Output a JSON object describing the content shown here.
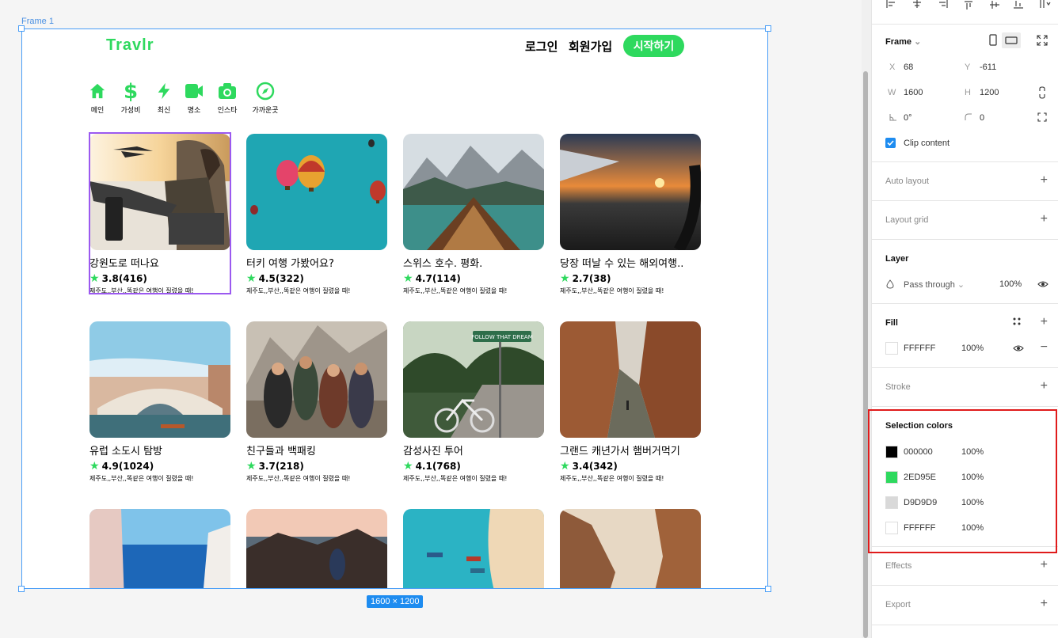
{
  "canvas": {
    "frame_label": "Frame 1",
    "size_badge": "1600 × 1200"
  },
  "site": {
    "logo": "Travlr",
    "nav": {
      "login": "로그인",
      "signup": "회원가입",
      "start": "시작하기"
    },
    "categories": [
      {
        "label": "메인",
        "icon": "home-icon"
      },
      {
        "label": "가성비",
        "icon": "dollar-icon"
      },
      {
        "label": "최신",
        "icon": "lightning-icon"
      },
      {
        "label": "명소",
        "icon": "video-icon"
      },
      {
        "label": "인스타",
        "icon": "camera-icon"
      },
      {
        "label": "가까운곳",
        "icon": "compass-icon"
      }
    ],
    "cards": [
      {
        "title": "강원도로 떠나요",
        "rating": "3.8(416)",
        "desc": "제주도,,부산,,똑같은 여행이 질렸을 때!"
      },
      {
        "title": "터키 여행 가봤어요?",
        "rating": "4.5(322)",
        "desc": "제주도,,부산,,똑같은 여행이 질렸을 때!"
      },
      {
        "title": "스위스 호수. 평화.",
        "rating": "4.7(114)",
        "desc": "제주도,,부산,,똑같은 여행이 질렸을 때!"
      },
      {
        "title": "당장 떠날 수 있는 해외여행..",
        "rating": "2.7(38)",
        "desc": "제주도,,부산,,똑같은 여행이 질렸을 때!"
      },
      {
        "title": "유럽 소도시 탐방",
        "rating": "4.9(1024)",
        "desc": "제주도,,부산,,똑같은 여행이 질렸을 때!"
      },
      {
        "title": "친구들과 백패킹",
        "rating": "3.7(218)",
        "desc": "제주도,,부산,,똑같은 여행이 질렸을 때!"
      },
      {
        "title": "감성사진 투어",
        "rating": "4.1(768)",
        "desc": "제주도,,부산,,똑같은 여행이 질렸을 때!"
      },
      {
        "title": "그랜드 캐년가서 햄버거먹기",
        "rating": "3.4(342)",
        "desc": "제주도,,부산,,똑같은 여행이 질렸을 때!"
      },
      {
        "title": "",
        "rating": "",
        "desc": ""
      },
      {
        "title": "",
        "rating": "",
        "desc": ""
      },
      {
        "title": "",
        "rating": "",
        "desc": ""
      },
      {
        "title": "",
        "rating": "",
        "desc": ""
      }
    ],
    "sign_text": "FOLLOW THAT DREAM"
  },
  "panel": {
    "frame": {
      "title": "Frame",
      "x_label": "X",
      "x": "68",
      "y_label": "Y",
      "y": "-611",
      "w_label": "W",
      "w": "1600",
      "h_label": "H",
      "h": "1200",
      "rotation": "0°",
      "radius": "0",
      "clip": "Clip content"
    },
    "auto_layout": "Auto layout",
    "layout_grid": "Layout grid",
    "layer": {
      "title": "Layer",
      "blend": "Pass through",
      "opacity": "100%"
    },
    "fill": {
      "title": "Fill",
      "hex": "FFFFFF",
      "opacity": "100%"
    },
    "stroke": "Stroke",
    "selection_colors": {
      "title": "Selection colors",
      "items": [
        {
          "hex": "000000",
          "opacity": "100%",
          "color": "#000000"
        },
        {
          "hex": "2ED95E",
          "opacity": "100%",
          "color": "#2ED95E"
        },
        {
          "hex": "D9D9D9",
          "opacity": "100%",
          "color": "#D9D9D9"
        },
        {
          "hex": "FFFFFF",
          "opacity": "100%",
          "color": "#FFFFFF"
        }
      ]
    },
    "effects": "Effects",
    "export": "Export"
  },
  "colors": {
    "accent": "#2ED95E",
    "selection": "#4A9EF7",
    "highlight": "#E01B1B"
  }
}
